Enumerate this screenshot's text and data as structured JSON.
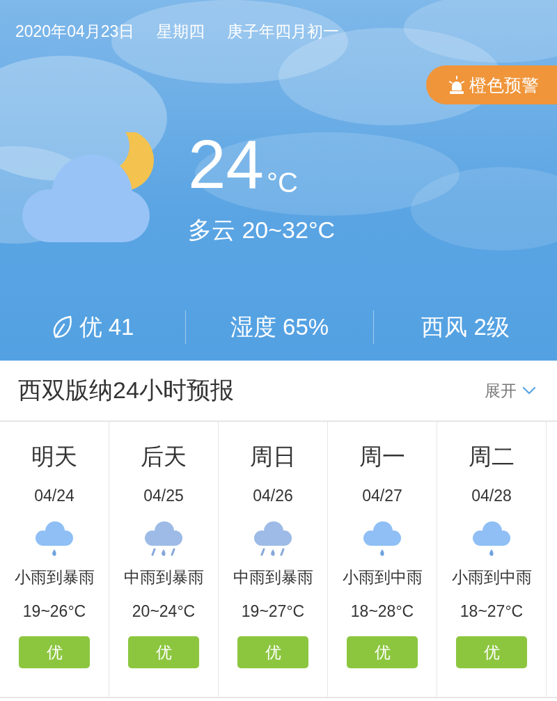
{
  "header": {
    "date": "2020年04月23日",
    "weekday": "星期四",
    "lunar": "庚子年四月初一",
    "alert": {
      "label": "橙色预警"
    },
    "current": {
      "kind": "cloudy-night",
      "temperature": "24",
      "unit": "°C",
      "summary": "多云 20~32°C"
    },
    "stats": [
      {
        "kind": "air",
        "label": "优 41"
      },
      {
        "kind": "humidity",
        "label": "湿度 65%"
      },
      {
        "kind": "wind",
        "label": "西风 2级"
      }
    ]
  },
  "forecast": {
    "title": "西双版纳24小时预报",
    "toggle": "展开",
    "days": [
      {
        "day": "明天",
        "date": "04/24",
        "kind": "light-rain",
        "weather": "小雨到暴雨",
        "temps": "19~26°C",
        "air": "优"
      },
      {
        "day": "后天",
        "date": "04/25",
        "kind": "moderate-rain",
        "weather": "中雨到暴雨",
        "temps": "20~24°C",
        "air": "优"
      },
      {
        "day": "周日",
        "date": "04/26",
        "kind": "moderate-rain",
        "weather": "中雨到暴雨",
        "temps": "19~27°C",
        "air": "优"
      },
      {
        "day": "周一",
        "date": "04/27",
        "kind": "light-rain",
        "weather": "小雨到中雨",
        "temps": "18~28°C",
        "air": "优"
      },
      {
        "day": "周二",
        "date": "04/28",
        "kind": "light-rain",
        "weather": "小雨到中雨",
        "temps": "18~27°C",
        "air": "优"
      }
    ]
  }
}
